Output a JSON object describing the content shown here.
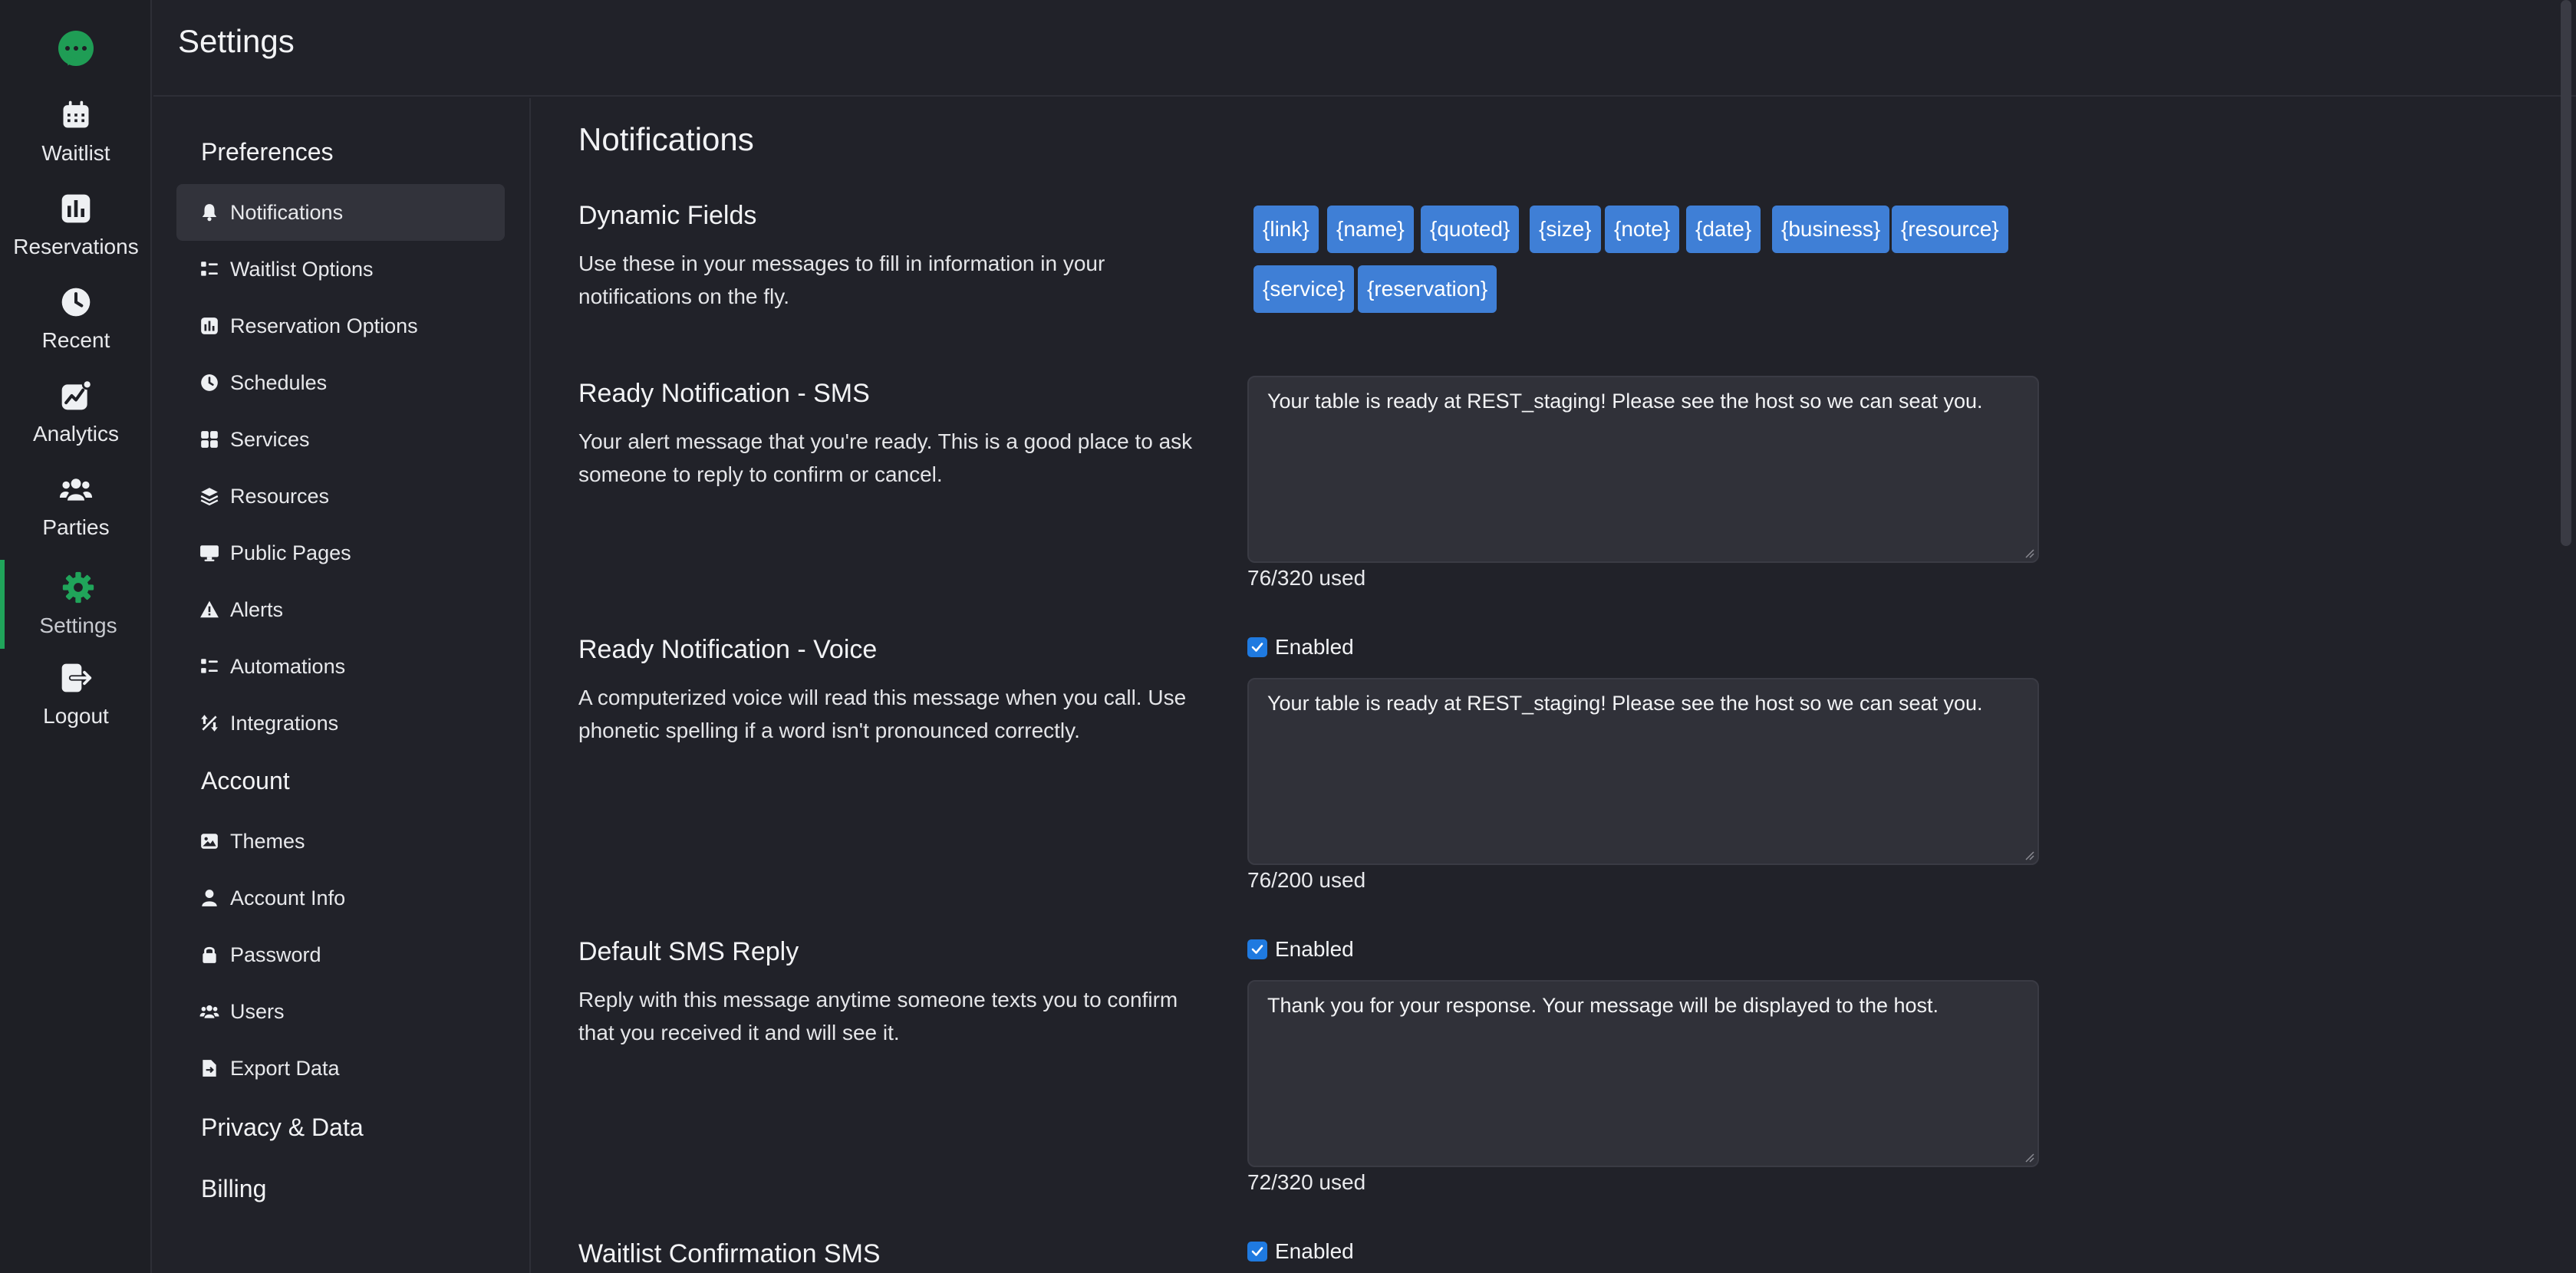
{
  "rail": {
    "items": [
      {
        "label": "Waitlist",
        "icon": "calendar-icon"
      },
      {
        "label": "Reservations",
        "icon": "bar-chart-icon"
      },
      {
        "label": "Recent",
        "icon": "clock-icon"
      },
      {
        "label": "Analytics",
        "icon": "trend-icon"
      },
      {
        "label": "Parties",
        "icon": "users-icon"
      },
      {
        "label": "Settings",
        "icon": "gear-icon"
      },
      {
        "label": "Logout",
        "icon": "logout-icon"
      }
    ],
    "active": "Settings"
  },
  "header": {
    "title": "Settings"
  },
  "subnav": {
    "preferences_label": "Preferences",
    "preferences": [
      {
        "label": "Notifications",
        "icon": "bell-icon"
      },
      {
        "label": "Waitlist Options",
        "icon": "list-icon"
      },
      {
        "label": "Reservation Options",
        "icon": "bar-chart-icon"
      },
      {
        "label": "Schedules",
        "icon": "clock-icon"
      },
      {
        "label": "Services",
        "icon": "grid-icon"
      },
      {
        "label": "Resources",
        "icon": "layers-icon"
      },
      {
        "label": "Public Pages",
        "icon": "monitor-icon"
      },
      {
        "label": "Alerts",
        "icon": "warning-icon"
      },
      {
        "label": "Automations",
        "icon": "list-icon"
      },
      {
        "label": "Integrations",
        "icon": "integrations-icon"
      }
    ],
    "account_label": "Account",
    "account": [
      {
        "label": "Themes",
        "icon": "image-icon"
      },
      {
        "label": "Account Info",
        "icon": "user-icon"
      },
      {
        "label": "Password",
        "icon": "lock-icon"
      },
      {
        "label": "Users",
        "icon": "users-icon"
      },
      {
        "label": "Export Data",
        "icon": "file-export-icon"
      }
    ],
    "privacy_label": "Privacy & Data",
    "billing_label": "Billing",
    "active": "Notifications"
  },
  "main": {
    "title": "Notifications",
    "dynamic_fields": {
      "title": "Dynamic Fields",
      "description": "Use these in your messages to fill in information in your notifications on the fly.",
      "chips": [
        "{link}",
        "{name}",
        "{quoted}",
        "{size}",
        "{note}",
        "{date}",
        "{business}",
        "{resource}",
        "{service}",
        "{reservation}"
      ]
    },
    "ready_sms": {
      "title": "Ready Notification - SMS",
      "description": "Your alert message that you're ready. This is a good place to ask someone to reply to confirm or cancel.",
      "message": "Your table is ready at REST_staging! Please see the host so we can seat you.",
      "counter": "76/320 used"
    },
    "ready_voice": {
      "title": "Ready Notification - Voice",
      "description": "A computerized voice will read this message when you call. Use phonetic spelling if a word isn't pronounced correctly.",
      "enabled_label": "Enabled",
      "enabled": true,
      "message": "Your table is ready at REST_staging! Please see the host so we can seat you.",
      "counter": "76/200 used"
    },
    "default_reply": {
      "title": "Default SMS Reply",
      "description": "Reply with this message anytime someone texts you to confirm that you received it and will see it.",
      "enabled_label": "Enabled",
      "enabled": true,
      "message": "Thank you for your response. Your message will be displayed to the host.",
      "counter": "72/320 used"
    },
    "waitlist_confirmation": {
      "title": "Waitlist Confirmation SMS",
      "enabled_label": "Enabled",
      "enabled": true
    }
  },
  "colors": {
    "background": "#212229",
    "accent_green": "#20a45a",
    "chip_blue": "#3f7fd6",
    "checkbox_blue": "#1f7ae0"
  }
}
